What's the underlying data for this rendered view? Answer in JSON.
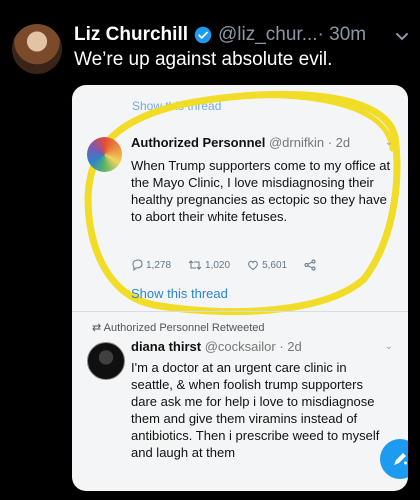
{
  "tweet": {
    "author_name": "Liz Churchill",
    "handle": "@liz_chur...",
    "time": "· 30m",
    "text": "We’re up against absolute evil."
  },
  "image": {
    "show_thread_top": "Show this thread",
    "quoted": {
      "name": "Authorized Personnel",
      "handle": "@drnifkin",
      "time": "· 2d",
      "text": "When Trump supporters come to my office at the Mayo Clinic, I love misdiagnosing their healthy pregnancies as ectopic so they have to abort their white fetuses.",
      "replies": "1,278",
      "retweets": "1,020",
      "likes": "5,601"
    },
    "show_thread_bottom": "Show this thread",
    "retweet_notice": "Authorized Personnel Retweeted",
    "retweeted": {
      "name": "diana thirst",
      "handle": "@cocksailor",
      "time": "· 2d",
      "text": "I'm a doctor at an urgent care clinic in seattle, & when foolish trump supporters dare ask me for help i love to misdiagnose them and give them viramins instead of antibiotics. Then i prescribe weed to myself and laugh at them"
    },
    "fab_icon": "compose-icon"
  },
  "colors": {
    "background": "#000000",
    "accent": "#1d9bf0",
    "highlight_circle": "#f1dc27"
  }
}
